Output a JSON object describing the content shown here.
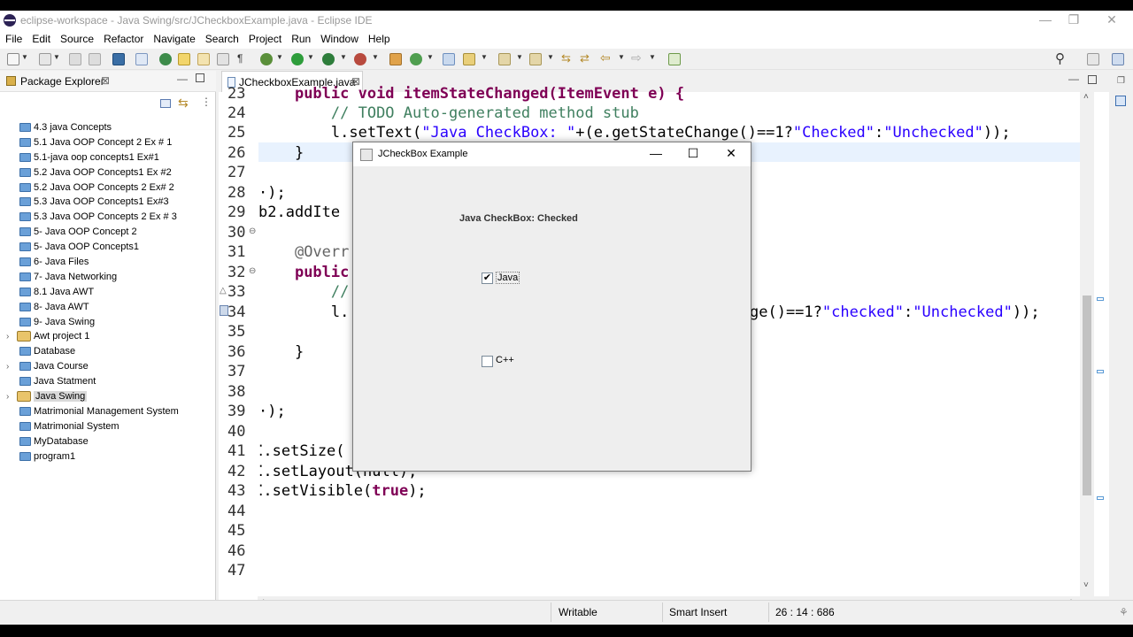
{
  "window": {
    "title": "eclipse-workspace - Java Swing/src/JCheckboxExample.java - Eclipse IDE",
    "minimize": "—",
    "restore": "❐",
    "close": "✕"
  },
  "menu": [
    "File",
    "Edit",
    "Source",
    "Refactor",
    "Navigate",
    "Search",
    "Project",
    "Run",
    "Window",
    "Help"
  ],
  "package_explorer": {
    "title": "Package Explorer",
    "close": "⊠",
    "items": [
      {
        "label": "4.3 java Concepts"
      },
      {
        "label": "5.1 Java OOP Concept 2 Ex # 1"
      },
      {
        "label": "5.1-java oop concepts1 Ex#1"
      },
      {
        "label": "5.2 Java OOP Concepts1 Ex #2"
      },
      {
        "label": "5.2 Java OOP Concepts 2 Ex# 2"
      },
      {
        "label": "5.3 Java OOP Concepts1 Ex#3"
      },
      {
        "label": "5.3 Java OOP Concepts 2 Ex # 3"
      },
      {
        "label": "5- Java OOP Concept 2"
      },
      {
        "label": "5- Java OOP Concepts1"
      },
      {
        "label": "6- Java Files"
      },
      {
        "label": "7- Java Networking"
      },
      {
        "label": "8.1 Java AWT"
      },
      {
        "label": "8- Java AWT"
      },
      {
        "label": "9- Java Swing"
      },
      {
        "label": "Awt project 1"
      },
      {
        "label": "Database"
      },
      {
        "label": "Java Course"
      },
      {
        "label": "Java Statment"
      },
      {
        "label": "Java Swing"
      },
      {
        "label": "Matrimonial Management System"
      },
      {
        "label": "Matrimonial System"
      },
      {
        "label": "MyDatabase"
      },
      {
        "label": "program1"
      }
    ]
  },
  "editor": {
    "tab": "JCheckboxExample.java",
    "tab_close": "⊠",
    "line_numbers": [
      "24",
      "25",
      "26",
      "27",
      "28",
      "29",
      "30",
      "31",
      "32",
      "33",
      "34",
      "35",
      "36",
      "37",
      "38",
      "39",
      "40",
      "41",
      "42",
      "43",
      "44",
      "45",
      "46",
      "47"
    ],
    "code": {
      "l23": "public void itemStateChanged(ItemEvent e) {",
      "l24_comment": "// TODO Auto-generated method stub",
      "l25_a": "l.setText(",
      "l25_s1": "\"Java CheckBox: \"",
      "l25_b": "+(e.getStateChange()==1?",
      "l25_s2": "\"Checked\"",
      "l25_c": ":",
      "l25_s3": "\"Unchecked\"",
      "l25_d": "));",
      "l26": "}",
      "l28": "·);",
      "l29": "b2.addIte",
      "l31": "@Overr",
      "l32": "public",
      "l33": "//",
      "l34_a": "l.",
      "l34_b": "ge()==1?",
      "l34_s1": "\"checked\"",
      "l34_c": ":",
      "l34_s2": "\"Unchecked\"",
      "l34_d": "));",
      "l36": "}",
      "l39": "·);",
      "l41": "⁚.setSize(",
      "l42": "⁚.setLayout(null);",
      "l43_a": "⁚.setVisible(",
      "l43_kw": "true",
      "l43_b": ");"
    }
  },
  "status": {
    "writable": "Writable",
    "insert": "Smart Insert",
    "position": "26 : 14 : 686"
  },
  "dialog": {
    "title": "JCheckBox Example",
    "minimize": "—",
    "maximize": "☐",
    "close": "✕",
    "label": "Java CheckBox: Checked",
    "checkbox1": {
      "label": "Java",
      "checked": true,
      "mark": "✔"
    },
    "checkbox2": {
      "label": "C++",
      "checked": false
    }
  }
}
